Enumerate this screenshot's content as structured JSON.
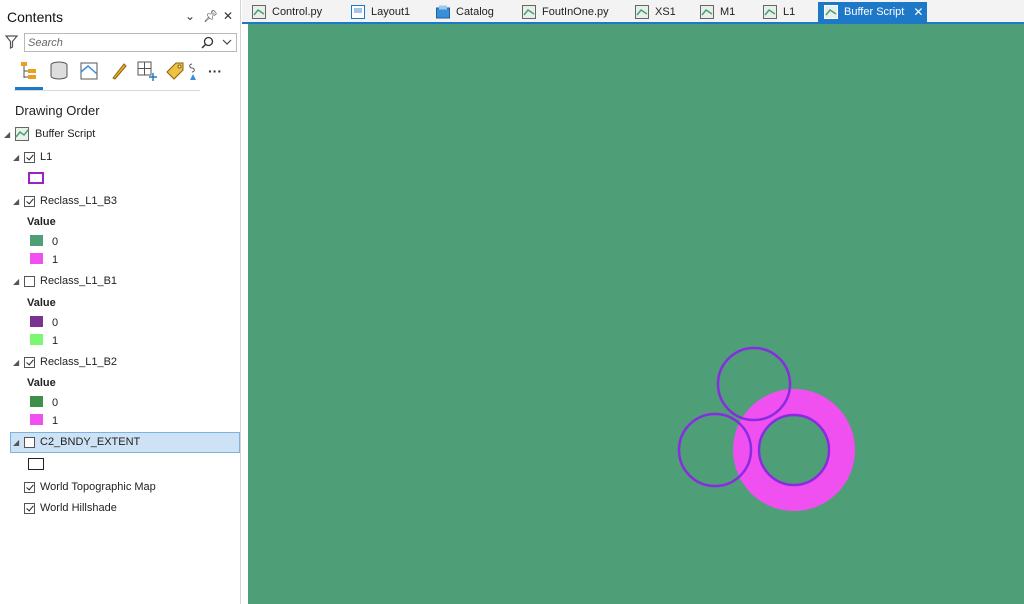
{
  "contents": {
    "title": "Contents",
    "search_placeholder": "Search",
    "section_title": "Drawing Order",
    "map_name": "Buffer Script",
    "value_label": "Value",
    "layers": {
      "l1": {
        "name": "L1",
        "checked": true
      },
      "b3": {
        "name": "Reclass_L1_B3",
        "checked": true,
        "classes": [
          {
            "label": "0",
            "color": "#4e9e78"
          },
          {
            "label": "1",
            "color": "#f050f0"
          }
        ]
      },
      "b1": {
        "name": "Reclass_L1_B1",
        "checked": false,
        "classes": [
          {
            "label": "0",
            "color": "#7a3390"
          },
          {
            "label": "1",
            "color": "#7cf870"
          }
        ]
      },
      "b2": {
        "name": "Reclass_L1_B2",
        "checked": true,
        "classes": [
          {
            "label": "0",
            "color": "#3d8f4a"
          },
          {
            "label": "1",
            "color": "#f050f0"
          }
        ]
      },
      "bndy": {
        "name": "C2_BNDY_EXTENT",
        "checked": false
      },
      "topo": {
        "name": "World Topographic Map",
        "checked": true
      },
      "hill": {
        "name": "World Hillshade",
        "checked": true
      }
    }
  },
  "tabs": [
    {
      "label": "Control.py",
      "icon": "python-script-icon"
    },
    {
      "label": "Layout1",
      "icon": "layout-icon"
    },
    {
      "label": "Catalog",
      "icon": "catalog-icon"
    },
    {
      "label": "FoutInOne.py",
      "icon": "python-script-icon"
    },
    {
      "label": "XS1",
      "icon": "map-icon"
    },
    {
      "label": "M1",
      "icon": "map-icon"
    },
    {
      "label": "L1",
      "icon": "map-icon"
    },
    {
      "label": "Buffer Script",
      "icon": "map-icon",
      "active": true
    }
  ],
  "colors": {
    "map_background": "#4e9e78",
    "buffer_fill": "#f050f0",
    "outline_purple": "#8a2be2",
    "accent": "#1e78c8"
  }
}
